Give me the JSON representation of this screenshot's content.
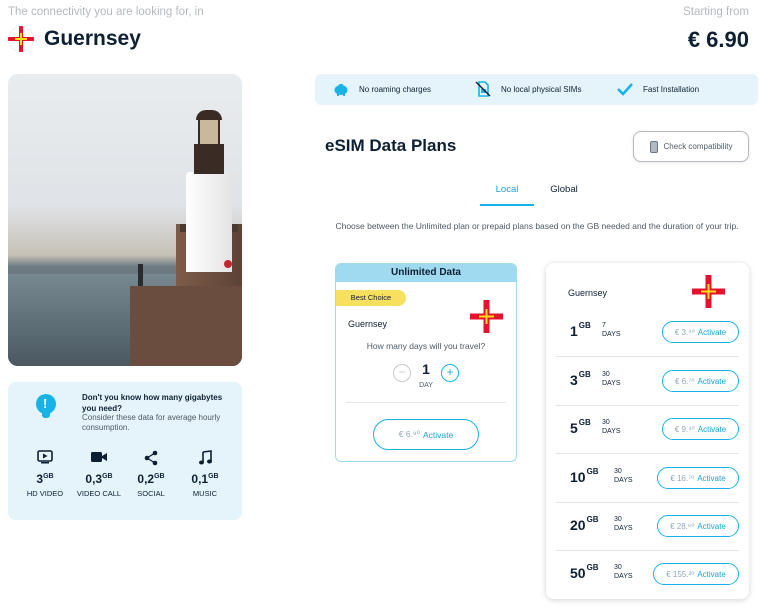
{
  "header": {
    "tagline": "The connectivity you are looking for, in",
    "country": "Guernsey",
    "starting_label": "Starting from",
    "price": "€ 6.90"
  },
  "info": {
    "question": "Don't you know how many gigabytes you need?",
    "subtext": "Consider these data for average hourly consumption.",
    "usage": [
      {
        "icon": "play-icon",
        "amount": "3",
        "unit": "GB",
        "label": "HD VIDEO"
      },
      {
        "icon": "video-camera-icon",
        "amount": "0,3",
        "unit": "GB",
        "label": "VIDEO CALL"
      },
      {
        "icon": "share-icon",
        "amount": "0,2",
        "unit": "GB",
        "label": "SOCIAL"
      },
      {
        "icon": "music-note-icon",
        "amount": "0,1",
        "unit": "GB",
        "label": "MUSIC"
      }
    ]
  },
  "features": [
    {
      "icon": "piggy-bank-icon",
      "label": "No roaming charges"
    },
    {
      "icon": "no-sim-icon",
      "label": "No local physical SIMs"
    },
    {
      "icon": "checkmark-icon",
      "label": "Fast Installation"
    }
  ],
  "plans": {
    "title": "eSIM Data Plans",
    "compat_label": "Check compatibility",
    "tabs": [
      {
        "label": "Local",
        "active": true
      },
      {
        "label": "Global",
        "active": false
      }
    ],
    "description": "Choose between the Unlimited plan or prepaid plans based on the GB needed and the duration of your trip."
  },
  "unlimited": {
    "header": "Unlimited Data",
    "badge": "Best Choice",
    "country": "Guernsey",
    "question": "How many days will you travel?",
    "minus": "−",
    "plus": "+",
    "days": "1",
    "day_label": "DAY",
    "price": "€ 6.⁹⁰",
    "activate": "Activate"
  },
  "prepaid": {
    "country": "Guernsey",
    "rows": [
      {
        "gb": "1",
        "unit": "GB",
        "days": "7",
        "days_label": "DAYS",
        "price": "€ 3.⁴⁰",
        "activate": "Activate"
      },
      {
        "gb": "3",
        "unit": "GB",
        "days": "30",
        "days_label": "DAYS",
        "price": "€ 6.⁷⁰",
        "activate": "Activate"
      },
      {
        "gb": "5",
        "unit": "GB",
        "days": "30",
        "days_label": "DAYS",
        "price": "€ 9.⁴⁰",
        "activate": "Activate"
      },
      {
        "gb": "10",
        "unit": "GB",
        "days": "30",
        "days_label": "DAYS",
        "price": "€ 16.⁷⁰",
        "activate": "Activate"
      },
      {
        "gb": "20",
        "unit": "GB",
        "days": "30",
        "days_label": "DAYS",
        "price": "€ 28.⁶⁰",
        "activate": "Activate"
      },
      {
        "gb": "50",
        "unit": "GB",
        "days": "30",
        "days_label": "DAYS",
        "price": "€ 155.²⁰",
        "activate": "Activate"
      }
    ]
  },
  "colors": {
    "accent": "#16b3e6",
    "accent_light": "#e5f4fb",
    "badge": "#f6e05e",
    "flag_red": "#e8112d",
    "flag_gold": "#f9dd16"
  }
}
